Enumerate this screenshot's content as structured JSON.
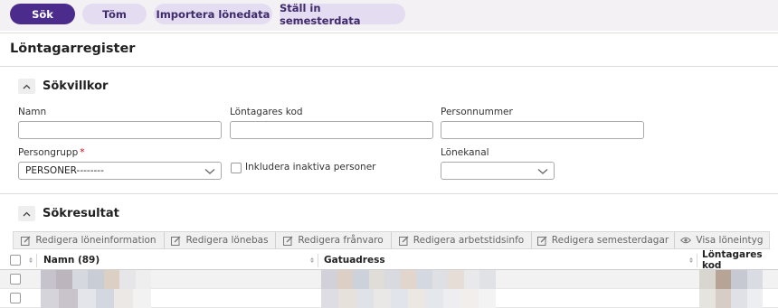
{
  "toolbar": {
    "search_label": "Sök",
    "clear_label": "Töm",
    "import_label": "Importera lönedata",
    "vacation_label": "Ställ in semesterdata"
  },
  "page": {
    "title": "Löntagarregister"
  },
  "search_section": {
    "title": "Sökvillkor",
    "fields": {
      "name_label": "Namn",
      "name_value": "",
      "code_label": "Löntagares kod",
      "code_value": "",
      "ssn_label": "Personnummer",
      "ssn_value": "",
      "group_label": "Persongrupp",
      "group_required_mark": "*",
      "group_value": "PERSONER--------",
      "include_inactive_label": "Inkludera inaktiva personer",
      "include_inactive_checked": false,
      "channel_label": "Lönekanal",
      "channel_value": ""
    }
  },
  "results_section": {
    "title": "Sökresultat",
    "actions": [
      "Redigera löneinformation",
      "Redigera lönebas",
      "Redigera frånvaro",
      "Redigera arbetstidsinfo",
      "Redigera semesterdagar",
      "Visa löneintyg"
    ],
    "columns": [
      "Namn (89)",
      "Gatuadress",
      "Löntagares kod"
    ]
  },
  "colors": {
    "primary": "#4b2b8c",
    "secondary": "#e4dcf1",
    "secondary_text": "#3f2a6b"
  }
}
